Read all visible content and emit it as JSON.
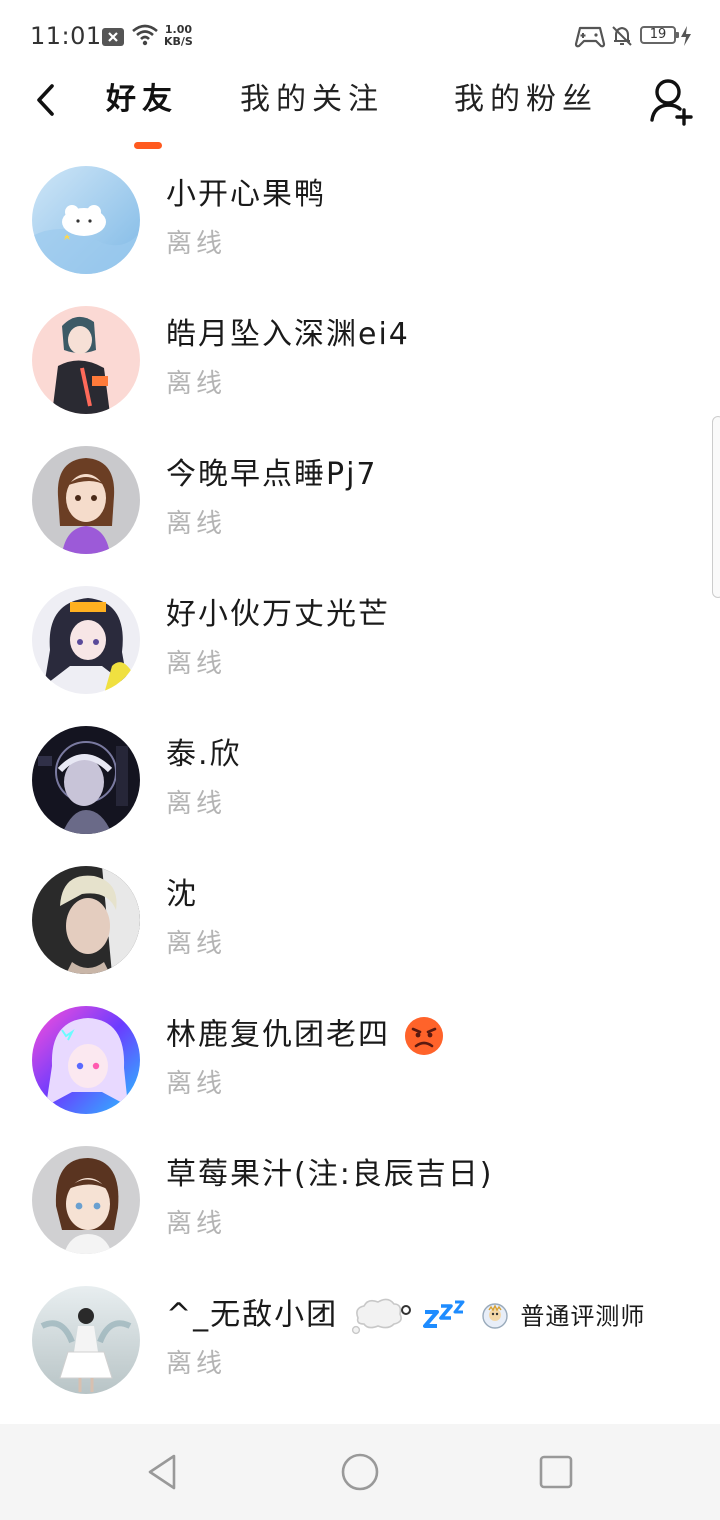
{
  "status_bar": {
    "time": "11:01",
    "net_speed_value": "1.00",
    "net_speed_unit": "KB/S",
    "battery_level": "19"
  },
  "header": {
    "tabs": [
      {
        "label": "好友",
        "active": true
      },
      {
        "label": "我的关注",
        "active": false
      },
      {
        "label": "我的粉丝",
        "active": false
      }
    ]
  },
  "friends": [
    {
      "name": "小开心果鸭",
      "status": "离线"
    },
    {
      "name": "皓月坠入深渊ei4",
      "status": "离线"
    },
    {
      "name": "今晚早点睡Pj7",
      "status": "离线"
    },
    {
      "name": "好小伙万丈光芒",
      "status": "离线"
    },
    {
      "name": "泰.欣",
      "status": "离线"
    },
    {
      "name": "沈",
      "status": "离线"
    },
    {
      "name": "林鹿复仇团老四",
      "status": "离线"
    },
    {
      "name": "草莓果汁(注:良辰吉日)",
      "status": "离线"
    },
    {
      "name": "^_无敌小团",
      "badge": "普通评测师",
      "status": "离线"
    }
  ],
  "colors": {
    "accent": "#ff5a1f",
    "status_text": "#b4b4b4",
    "nav_background": "#f5f5f5"
  }
}
